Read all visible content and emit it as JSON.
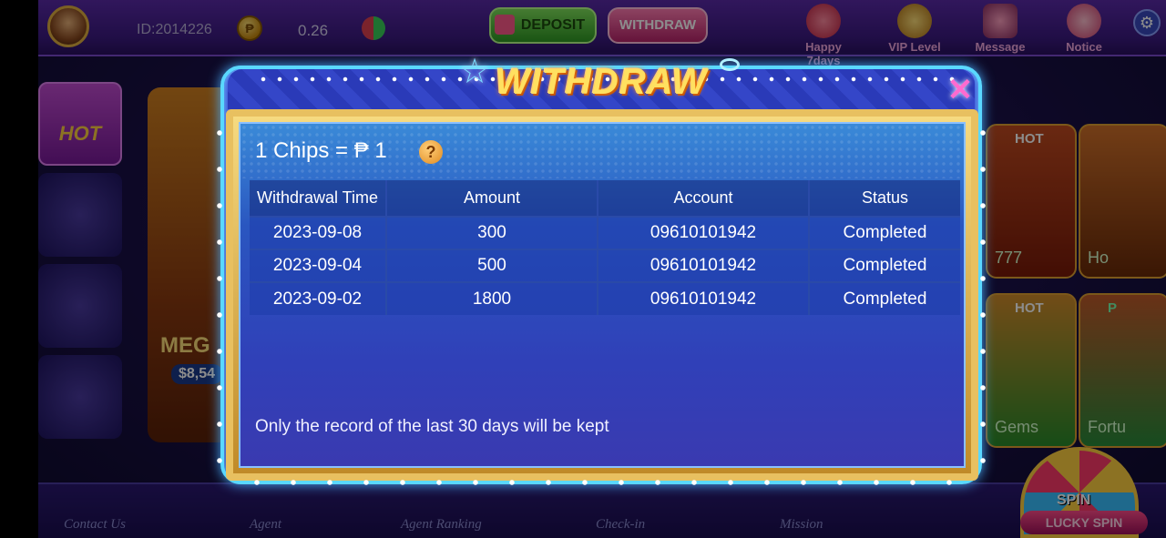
{
  "topbar": {
    "user_id": "ID:2014226",
    "coin_symbol": "₱",
    "balance": "0.26",
    "deposit_label": "DEPOSIT",
    "withdraw_label": "WITHDRAW",
    "icons": [
      {
        "label": "Happy 7days",
        "icon": "happy-7days-icon",
        "color": "#e04060"
      },
      {
        "label": "VIP Level",
        "icon": "vip-level-icon",
        "color": "#e0a020"
      },
      {
        "label": "Message",
        "icon": "message-icon",
        "color": "#c04a80"
      },
      {
        "label": "Notice",
        "icon": "notice-icon",
        "color": "#e06080"
      }
    ]
  },
  "side_nav": {
    "hot_label": "HOT"
  },
  "lobby": {
    "left_card_text1": "MEG",
    "left_card_text2": "$8,54",
    "cards": [
      {
        "badge": "HOT",
        "label": "777"
      },
      {
        "badge": "",
        "label": "Ho"
      },
      {
        "badge": "HOT",
        "label": "Gems"
      },
      {
        "badge": "P",
        "label": "Fortu"
      }
    ]
  },
  "bottombar": {
    "items": [
      "Contact Us",
      "Agent",
      "Agent Ranking",
      "Check-in",
      "Mission"
    ],
    "lucky_spin": "LUCKY SPIN",
    "spin": "SPIN"
  },
  "modal": {
    "title": "WITHDRAW",
    "rate_text": "1 Chips = ₱ 1",
    "help": "?",
    "close": "✕",
    "columns": [
      "Withdrawal Time",
      "Amount",
      "Account",
      "Status"
    ],
    "rows": [
      [
        "2023-09-08",
        "300",
        "09610101942",
        "Completed"
      ],
      [
        "2023-09-04",
        "500",
        "09610101942",
        "Completed"
      ],
      [
        "2023-09-02",
        "1800",
        "09610101942",
        "Completed"
      ]
    ],
    "note": "Only the record of the last 30 days will be kept"
  }
}
